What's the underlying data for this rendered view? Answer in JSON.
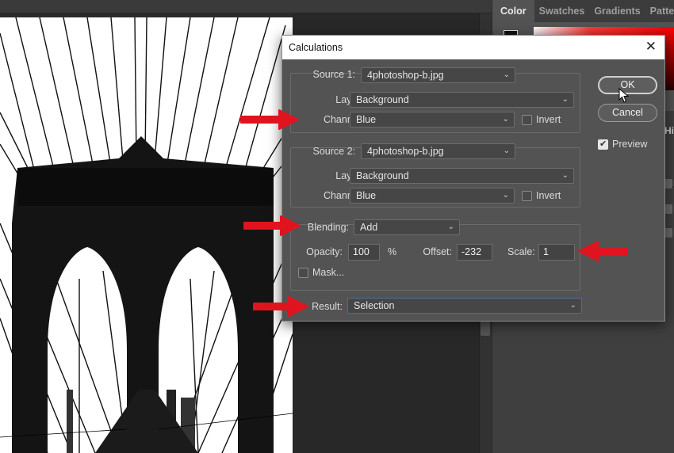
{
  "panel_tabs": [
    "Color",
    "Swatches",
    "Gradients",
    "Patter"
  ],
  "panel_side_text": "Hi",
  "dialog": {
    "title": "Calculations",
    "close_glyph": "✕",
    "source1": {
      "label": "Source 1:",
      "file": "4photoshop-b.jpg",
      "layer_label": "Layer:",
      "layer": "Background",
      "channel_label": "Channel:",
      "channel": "Blue",
      "invert_label": "Invert",
      "invert_checked": false
    },
    "source2": {
      "label": "Source 2:",
      "file": "4photoshop-b.jpg",
      "layer_label": "Layer:",
      "layer": "Background",
      "channel_label": "Channel:",
      "channel": "Blue",
      "invert_label": "Invert",
      "invert_checked": false
    },
    "blending": {
      "label": "Blending:",
      "mode": "Add",
      "opacity_label": "Opacity:",
      "opacity": "100",
      "opacity_unit": "%",
      "offset_label": "Offset:",
      "offset": "-232",
      "scale_label": "Scale:",
      "scale": "1",
      "mask_label": "Mask...",
      "mask_checked": false
    },
    "result": {
      "label": "Result:",
      "value": "Selection"
    },
    "ok_label": "OK",
    "cancel_label": "Cancel",
    "preview_label": "Preview",
    "preview_checked": true
  },
  "colors": {
    "annotation_arrow": "#e0141e",
    "dialog_bg": "#535353",
    "panel_bg": "#535353"
  },
  "icons": [
    "chevron-down-icon",
    "close-icon",
    "checkbox-icon",
    "arrow-annotation-icon",
    "cursor-pointer-icon"
  ]
}
